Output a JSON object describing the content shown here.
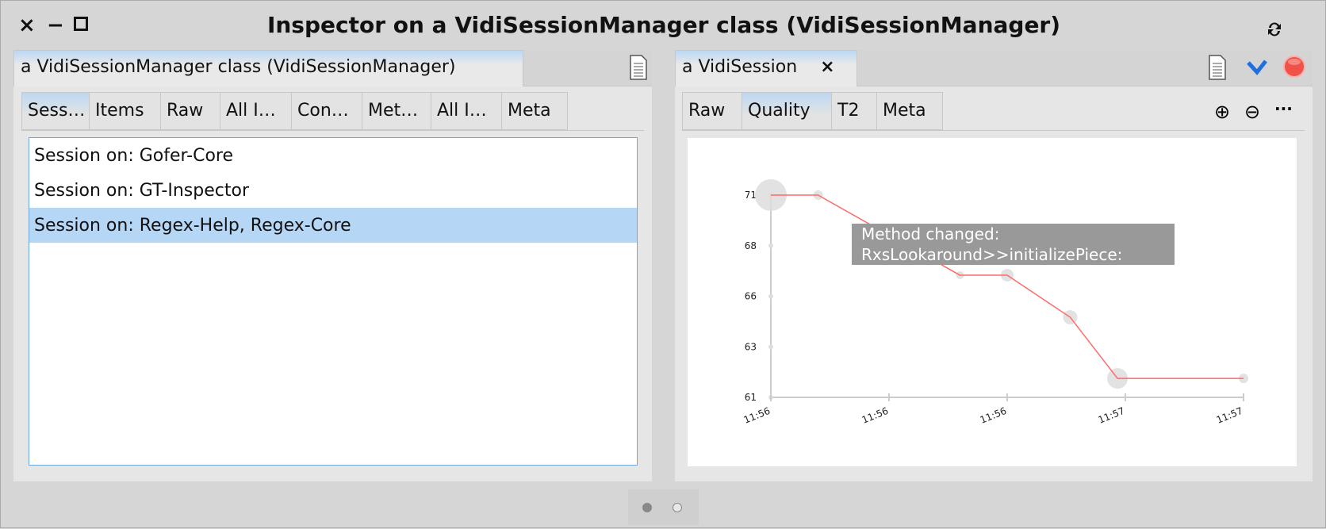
{
  "window": {
    "title": "Inspector on a VidiSessionManager class (VidiSessionManager)",
    "close_icon": "×",
    "minimize_icon": "−",
    "maximize_icon": "□",
    "refresh_icon": "refresh-icon"
  },
  "left": {
    "tab_label": "a VidiSessionManager class (VidiSessionManager)",
    "subtabs": [
      "Sess…",
      "Items",
      "Raw",
      "All I…",
      "Con…",
      "Met…",
      "All I…",
      "Meta"
    ],
    "selected_subtab": 0,
    "items": [
      "Session on: Gofer-Core",
      "Session on: GT-Inspector",
      "Session on: Regex-Help, Regex-Core"
    ],
    "selected_item": 2
  },
  "right": {
    "tab_label": "a VidiSession",
    "close_label": "×",
    "subtabs": [
      "Raw",
      "Quality",
      "T2",
      "Meta"
    ],
    "selected_subtab": 1,
    "zoom_in_icon": "⊕",
    "zoom_out_icon": "⊖",
    "more_label": "···"
  },
  "tooltip": {
    "line1": "Method changed:",
    "line2": "RxsLookaround>>initializePiece:"
  },
  "chart_data": {
    "type": "line",
    "ylim": [
      61.4,
      71
    ],
    "y_ticks": [
      "61",
      "63",
      "66",
      "68",
      "71"
    ],
    "x_ticks": [
      "11:56",
      "11:56",
      "11:56",
      "11:57",
      "11:57"
    ],
    "x_range": [
      "11:56:24",
      "11:57:24"
    ],
    "points": [
      {
        "x": "11:56:24",
        "y": 71
      },
      {
        "x": "11:56:30",
        "y": 71
      },
      {
        "x": "11:56:48",
        "y": 67.2
      },
      {
        "x": "11:56:54",
        "y": 67.2
      },
      {
        "x": "11:57:02",
        "y": 65.2
      },
      {
        "x": "11:57:08",
        "y": 62.3
      },
      {
        "x": "11:57:24",
        "y": 62.3
      }
    ],
    "line_color": "#ff6a6a",
    "grid": false
  },
  "pager": {
    "pages": 2,
    "current": 1
  },
  "colors": {
    "accent": "#6fa7df",
    "selection": "#b5d6f5",
    "close_red": "#f0524a",
    "check_blue": "#1f6fe0"
  }
}
